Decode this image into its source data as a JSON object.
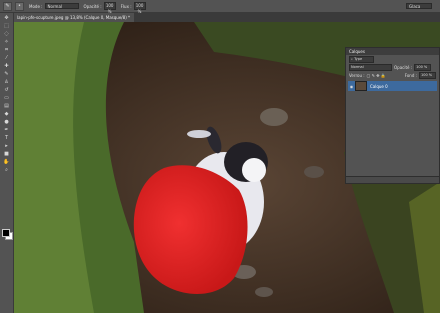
{
  "app": {
    "options_bar": {
      "tool_icon": "brush-icon",
      "mode_label": "Mode :",
      "mode_value": "Normal",
      "opacity_label": "Opacité :",
      "opacity_value": "100 %",
      "flow_label": "Flux :",
      "flow_value": "100 %",
      "workspace": "Glaca"
    },
    "document_tab": {
      "title": "lapin-pfe-scupture.jpeg @ 13,8% (Calque 0, Masque/8) *"
    },
    "tools": [
      "move-icon",
      "marquee-icon",
      "lasso-icon",
      "quick-select-icon",
      "crop-icon",
      "eyedropper-icon",
      "heal-icon",
      "brush-icon",
      "stamp-icon",
      "history-brush-icon",
      "eraser-icon",
      "gradient-icon",
      "blur-icon",
      "dodge-icon",
      "pen-icon",
      "text-icon",
      "path-select-icon",
      "shape-icon",
      "hand-icon",
      "zoom-icon"
    ],
    "layers_panel": {
      "title": "Calques",
      "kind_filter": "Type",
      "blend_mode": "Normal",
      "opacity_label": "Opacité :",
      "opacity_value": "100 %",
      "lock_label": "Verrou :",
      "fill_label": "Fond :",
      "fill_value": "100 %",
      "layers": [
        {
          "name": "Calque 0",
          "visible": true
        }
      ]
    },
    "colors": {
      "mask_overlay": "#e02020",
      "selected_layer": "#3d6a9e"
    }
  }
}
